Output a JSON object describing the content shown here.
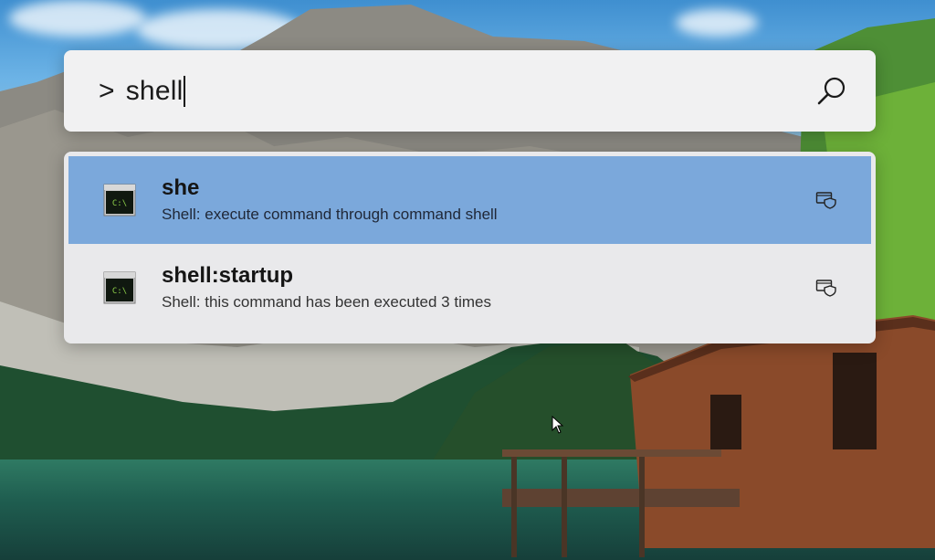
{
  "search": {
    "prompt": ">",
    "query": "shell"
  },
  "results": [
    {
      "title": "she",
      "subtitle": "Shell: execute command through command shell",
      "icon": "terminal-icon",
      "icon_text": "C:\\",
      "action_icon": "run-as-admin-icon",
      "selected": true
    },
    {
      "title": "shell:startup",
      "subtitle": "Shell: this command has been executed 3 times",
      "icon": "terminal-icon",
      "icon_text": "C:\\",
      "action_icon": "run-as-admin-icon",
      "selected": false
    }
  ],
  "colors": {
    "selected_row": "#7ba8db",
    "panel_background": "#e9e9eb",
    "searchbar_background": "#f1f1f2"
  }
}
